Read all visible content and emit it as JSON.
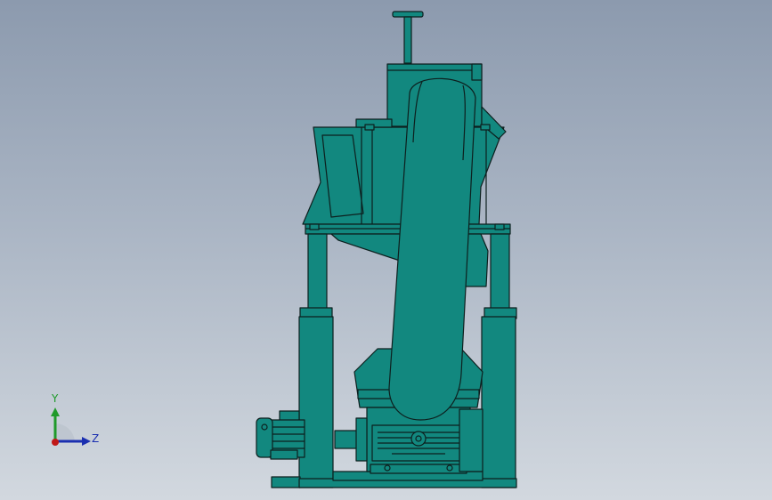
{
  "viewport": {
    "background_top": "#8c9aae",
    "background_bottom": "#d2d8df"
  },
  "model": {
    "part_color": "#12887f",
    "edge_color": "#0d1f1e"
  },
  "triad": {
    "y_label": "Y",
    "z_label": "Z",
    "y_color": "#1f9a2a",
    "z_color": "#1a2fb0",
    "x_color": "#c01818"
  }
}
